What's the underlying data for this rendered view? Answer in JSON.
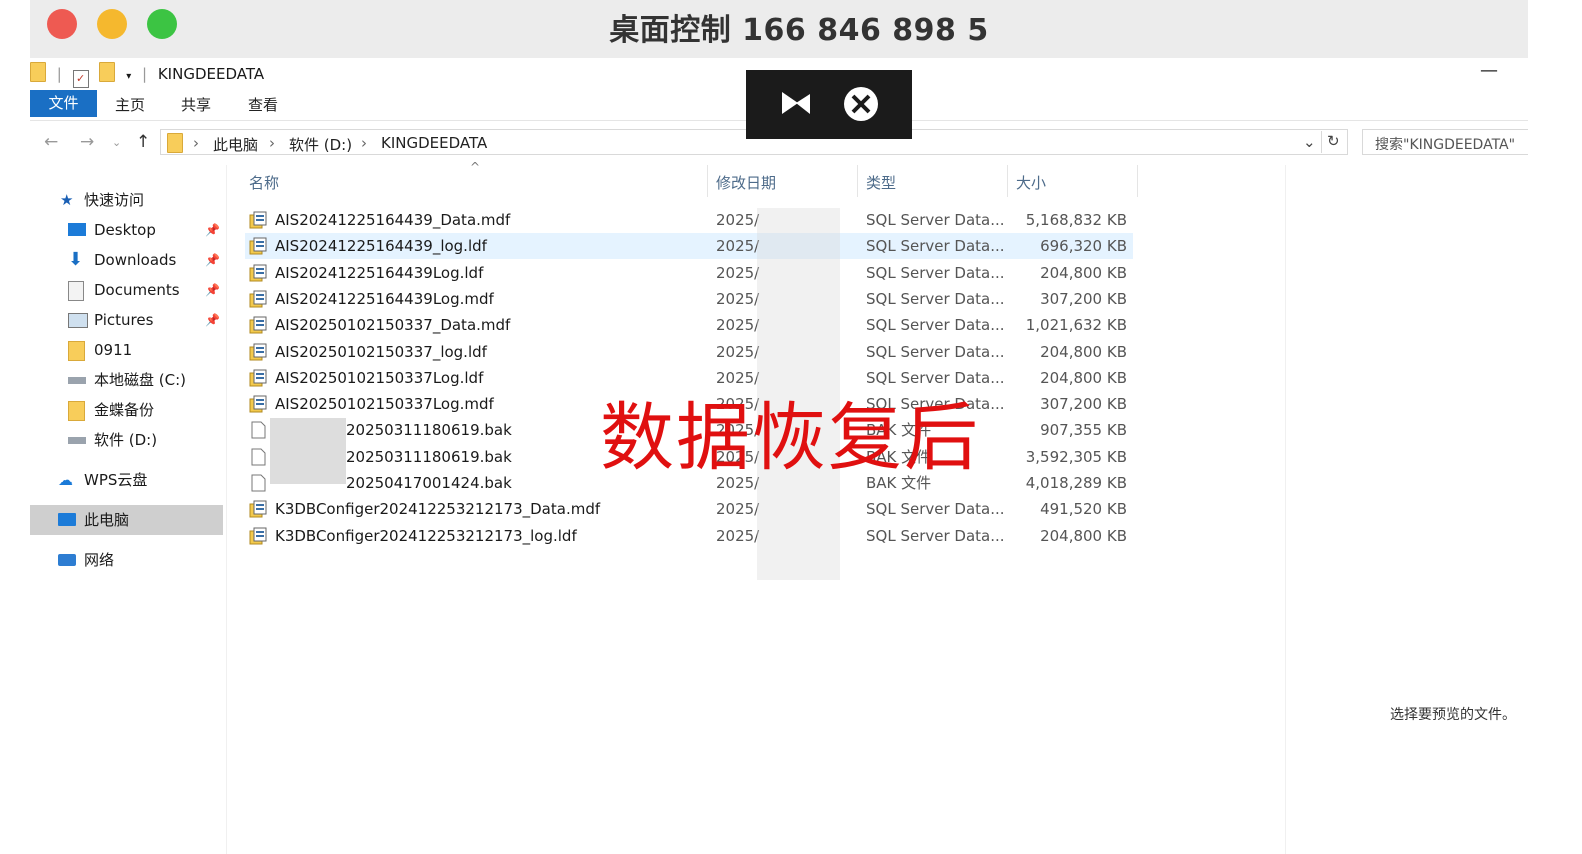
{
  "window": {
    "title": "桌面控制 166 846 898 5",
    "colors": {
      "close": "#ee5a52",
      "minimize": "#f5b82e",
      "maximize": "#3cc443"
    }
  },
  "explorer": {
    "qat_title": "KINGDEEDATA",
    "tabs": {
      "file": "文件",
      "home": "主页",
      "share": "共享",
      "view": "查看"
    },
    "breadcrumb": [
      "此电脑",
      "软件 (D:)",
      "KINGDEEDATA"
    ],
    "search_placeholder": "搜索\"KINGDEEDATA\"",
    "preview_text": "选择要预览的文件。"
  },
  "sidebar": {
    "quick_access": "快速访问",
    "items": [
      {
        "label": "Desktop",
        "icon": "desktop-icon",
        "pinned": true
      },
      {
        "label": "Downloads",
        "icon": "download-icon",
        "pinned": true
      },
      {
        "label": "Documents",
        "icon": "documents-icon",
        "pinned": true
      },
      {
        "label": "Pictures",
        "icon": "pictures-icon",
        "pinned": true
      },
      {
        "label": "0911",
        "icon": "folder-icon",
        "pinned": false
      },
      {
        "label": "本地磁盘 (C:)",
        "icon": "drive-icon",
        "pinned": false
      },
      {
        "label": "金蝶备份",
        "icon": "folder-icon",
        "pinned": false
      },
      {
        "label": "软件 (D:)",
        "icon": "drive-icon",
        "pinned": false
      }
    ],
    "wps": "WPS云盘",
    "this_pc": "此电脑",
    "network": "网络"
  },
  "columns": {
    "name": "名称",
    "date": "修改日期",
    "type": "类型",
    "size": "大小"
  },
  "files": [
    {
      "name": "AIS20241225164439_Data.mdf",
      "date": "2025/",
      "type": "SQL Server Data...",
      "size": "5,168,832 KB",
      "icon": "sql-database-icon"
    },
    {
      "name": "AIS20241225164439_log.ldf",
      "date": "2025/",
      "type": "SQL Server Data...",
      "size": "696,320 KB",
      "icon": "sql-database-icon"
    },
    {
      "name": "AIS20241225164439Log.ldf",
      "date": "2025/",
      "type": "SQL Server Data...",
      "size": "204,800 KB",
      "icon": "sql-database-icon"
    },
    {
      "name": "AIS20241225164439Log.mdf",
      "date": "2025/",
      "type": "SQL Server Data...",
      "size": "307,200 KB",
      "icon": "sql-database-icon"
    },
    {
      "name": "AIS20250102150337_Data.mdf",
      "date": "2025/",
      "type": "SQL Server Data...",
      "size": "1,021,632 KB",
      "icon": "sql-database-icon"
    },
    {
      "name": "AIS20250102150337_log.ldf",
      "date": "2025/",
      "type": "SQL Server Data...",
      "size": "204,800 KB",
      "icon": "sql-database-icon"
    },
    {
      "name": "AIS20250102150337Log.ldf",
      "date": "2025/",
      "type": "SQL Server Data...",
      "size": "204,800 KB",
      "icon": "sql-database-icon"
    },
    {
      "name": "AIS20250102150337Log.mdf",
      "date": "2025/",
      "type": "SQL Server Data...",
      "size": "307,200 KB",
      "icon": "sql-database-icon"
    },
    {
      "name": "20250311180619.bak",
      "date": "2025/",
      "type": "BAK 文件",
      "size": "907,355 KB",
      "icon": "file-icon"
    },
    {
      "name": "20250311180619.bak",
      "date": "2025/",
      "type": "BAK 文件",
      "size": "3,592,305 KB",
      "icon": "file-icon"
    },
    {
      "name": "20250417001424.bak",
      "date": "2025/",
      "type": "BAK 文件",
      "size": "4,018,289 KB",
      "icon": "file-icon"
    },
    {
      "name": "K3DBConfiger202412253212173_Data.mdf",
      "date": "2025/",
      "type": "SQL Server Data...",
      "size": "491,520 KB",
      "icon": "sql-database-icon"
    },
    {
      "name": "K3DBConfiger202412253212173_log.ldf",
      "date": "2025/",
      "type": "SQL Server Data...",
      "size": "204,800 KB",
      "icon": "sql-database-icon"
    }
  ],
  "watermark": "数据恢复后"
}
